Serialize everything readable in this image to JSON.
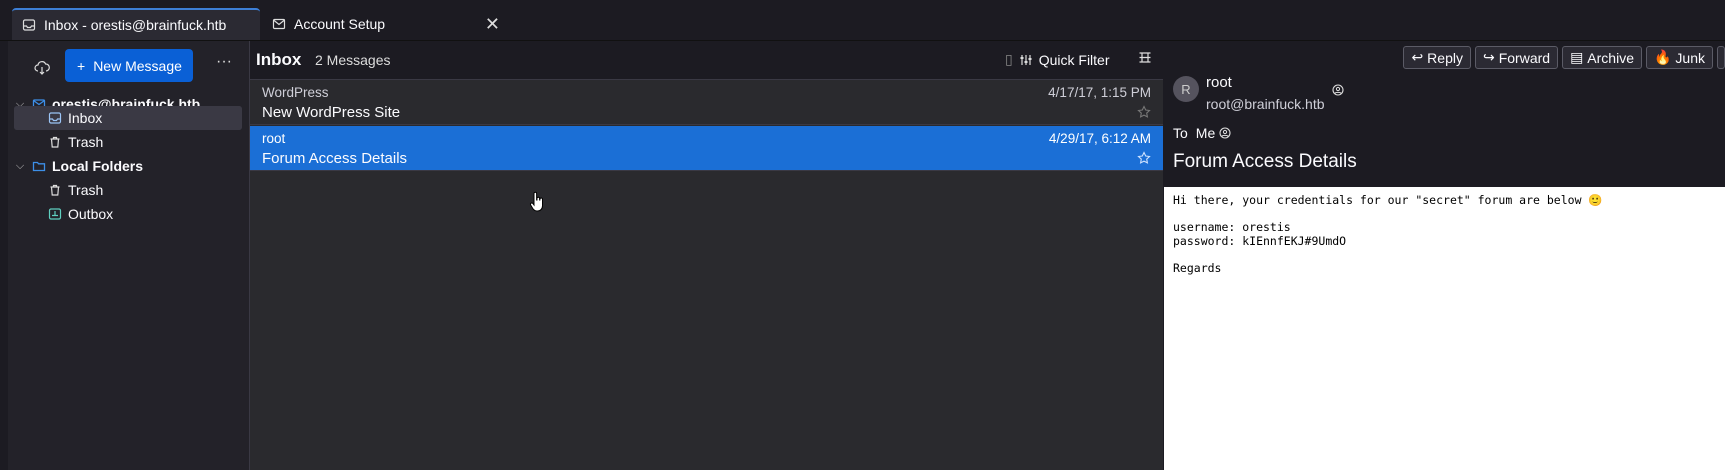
{
  "tabs": [
    {
      "label": "Inbox - orestis@brainfuck.htb",
      "icon": "inbox-icon"
    },
    {
      "label": "Account Setup",
      "icon": "account-setup-icon"
    }
  ],
  "folder_pane": {
    "new_message_label": "New Message",
    "account": "orestis@brainfuck.htb",
    "account_folders": [
      {
        "label": "Inbox",
        "icon": "inbox-icon",
        "selected": true
      },
      {
        "label": "Trash",
        "icon": "trash-icon"
      }
    ],
    "local_folders_label": "Local Folders",
    "local_folders": [
      {
        "label": "Trash",
        "icon": "trash-icon"
      },
      {
        "label": "Outbox",
        "icon": "outbox-icon"
      }
    ]
  },
  "message_list": {
    "title": "Inbox",
    "count": "2 Messages",
    "quick_filter_label": "Quick Filter",
    "messages": [
      {
        "sender": "WordPress",
        "subject": "New WordPress Site",
        "date": "4/17/17, 1:15 PM",
        "selected": false
      },
      {
        "sender": "root",
        "subject": "Forum Access Details",
        "date": "4/29/17, 6:12 AM",
        "selected": true
      }
    ]
  },
  "reader": {
    "toolbar": [
      "Reply",
      "Forward",
      "Archive",
      "Junk"
    ],
    "avatar_initial": "R",
    "from_name": "root",
    "from_email": "root@brainfuck.htb",
    "to_label": "To",
    "to_value": "Me",
    "subject": "Forum Access Details",
    "body_lines": [
      "Hi there, your credentials for our \"secret\" forum are below 🙂",
      "",
      "username: orestis",
      "password: kIEnnfEKJ#9UmdO",
      "",
      "Regards"
    ]
  },
  "colors": {
    "accent": "#0a60d6",
    "selected_row": "#1b6fd6"
  }
}
